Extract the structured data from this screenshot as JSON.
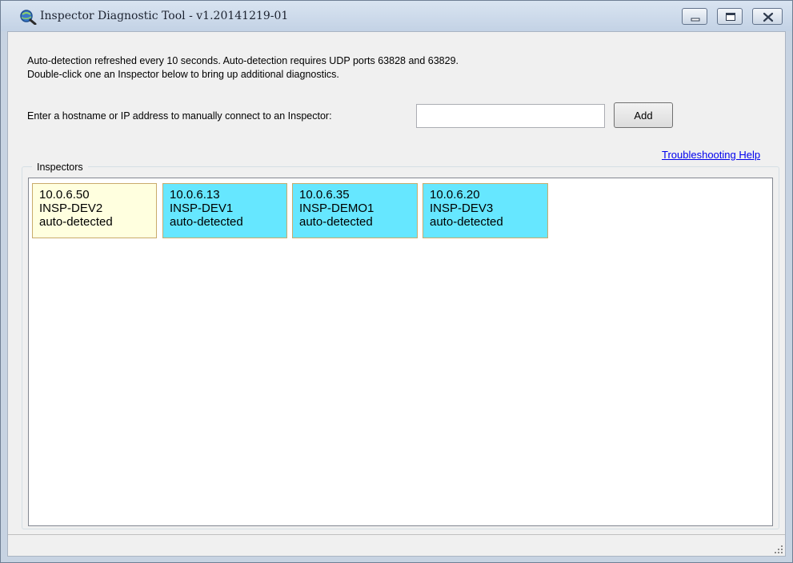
{
  "window": {
    "title": "Inspector Diagnostic Tool - v1.20141219-01"
  },
  "info": {
    "line1": "Auto-detection refreshed every 10 seconds. Auto-detection requires UDP ports 63828 and 63829.",
    "line2": "Double-click one an Inspector below to bring up additional diagnostics."
  },
  "manual": {
    "label": "Enter a hostname or IP address to manually connect to an Inspector:",
    "input_value": "",
    "add_label": "Add"
  },
  "help_link": "Troubleshooting Help",
  "group": {
    "title": "Inspectors"
  },
  "inspectors": [
    {
      "ip": "10.0.6.50",
      "name": "INSP-DEV2",
      "status": "auto-detected",
      "color": "#ffffdf"
    },
    {
      "ip": "10.0.6.13",
      "name": "INSP-DEV1",
      "status": "auto-detected",
      "color": "#66e7ff"
    },
    {
      "ip": "10.0.6.35",
      "name": "INSP-DEMO1",
      "status": "auto-detected",
      "color": "#66e7ff"
    },
    {
      "ip": "10.0.6.20",
      "name": "INSP-DEV3",
      "status": "auto-detected",
      "color": "#66e7ff"
    }
  ],
  "icons": {
    "app": "magnifier-globe-icon",
    "minimize": "minimize-icon",
    "maximize": "maximize-icon",
    "close": "close-icon",
    "grip": "resize-grip-icon"
  }
}
